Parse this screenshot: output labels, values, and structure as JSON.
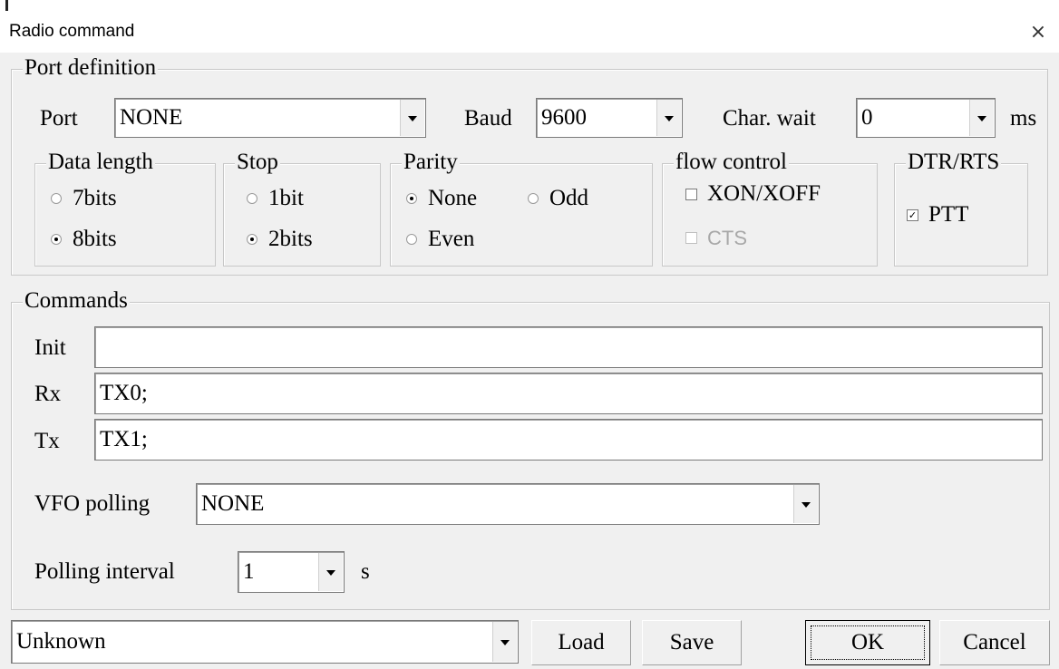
{
  "window": {
    "title": "Radio command",
    "close_glyph": "×"
  },
  "port_definition": {
    "legend": "Port definition",
    "port": {
      "label": "Port",
      "value": "NONE"
    },
    "baud": {
      "label": "Baud",
      "value": "9600"
    },
    "char_wait": {
      "label": "Char. wait",
      "value": "0",
      "unit": "ms"
    }
  },
  "data_length": {
    "legend": "Data length",
    "options": [
      {
        "label": "7bits",
        "checked": false
      },
      {
        "label": "8bits",
        "checked": true
      }
    ]
  },
  "stop": {
    "legend": "Stop",
    "options": [
      {
        "label": "1bit",
        "checked": false
      },
      {
        "label": "2bits",
        "checked": true
      }
    ]
  },
  "parity": {
    "legend": "Parity",
    "options": [
      {
        "label": "None",
        "checked": true
      },
      {
        "label": "Odd",
        "checked": false
      },
      {
        "label": "Even",
        "checked": false
      }
    ]
  },
  "flow_control": {
    "legend": "flow control",
    "xon_xoff": {
      "label": "XON/XOFF",
      "checked": false
    },
    "cts": {
      "label": "CTS",
      "checked": false,
      "disabled": true
    }
  },
  "dtr_rts": {
    "legend": "DTR/RTS",
    "ptt": {
      "label": "PTT",
      "checked": true
    }
  },
  "commands": {
    "legend": "Commands",
    "init": {
      "label": "Init",
      "value": ""
    },
    "rx": {
      "label": "Rx",
      "value": "TX0;"
    },
    "tx": {
      "label": "Tx",
      "value": "TX1;"
    },
    "vfo_polling": {
      "label": "VFO polling",
      "value": "NONE"
    },
    "polling_interval": {
      "label": "Polling interval",
      "value": "1",
      "unit": "s"
    }
  },
  "footer": {
    "preset": "Unknown",
    "load": "Load",
    "save": "Save",
    "ok": "OK",
    "cancel": "Cancel"
  },
  "check_glyph": "✓",
  "icons": {
    "close": "close-icon",
    "dropdown": "chevron-down-icon"
  }
}
